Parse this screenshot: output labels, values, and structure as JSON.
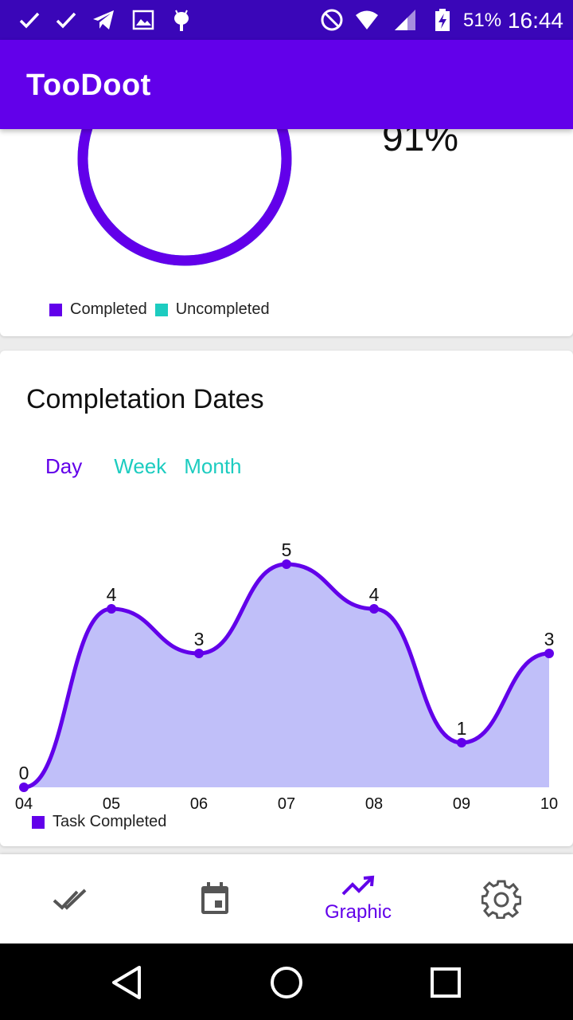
{
  "status_bar": {
    "battery": "51%",
    "time": "16:44"
  },
  "app_bar": {
    "title": "TooDoot"
  },
  "summary_card": {
    "percent_text": "91%",
    "completed_fraction": 0.91,
    "legend": [
      {
        "label": "Completed",
        "color": "#6200ea"
      },
      {
        "label": "Uncompleted",
        "color": "#1dccc0"
      }
    ]
  },
  "dates_card": {
    "title": "Completation Dates",
    "tabs": [
      {
        "label": "Day",
        "active": true
      },
      {
        "label": "Week",
        "active": false
      },
      {
        "label": "Month",
        "active": false
      }
    ]
  },
  "chart_data": {
    "type": "area",
    "categories": [
      "04",
      "05",
      "06",
      "07",
      "08",
      "09",
      "10"
    ],
    "series": [
      {
        "name": "Task Completed",
        "values": [
          0,
          4,
          3,
          5,
          4,
          1,
          3
        ],
        "color": "#6200ea",
        "fill": "#c0bff9"
      }
    ],
    "ylim": [
      0,
      5
    ],
    "grid": false,
    "legend": "bottom-left"
  },
  "bottom_nav": {
    "items": [
      {
        "icon": "double-check-icon",
        "label": ""
      },
      {
        "icon": "calendar-icon",
        "label": ""
      },
      {
        "icon": "trending-up-icon",
        "label": "Graphic"
      },
      {
        "icon": "gear-icon",
        "label": ""
      }
    ]
  },
  "colors": {
    "primary": "#6200ea",
    "primary_dark": "#3a06b8",
    "accent": "#1dccc0"
  }
}
